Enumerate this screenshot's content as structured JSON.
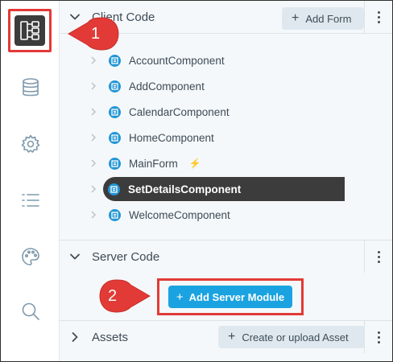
{
  "rail": {
    "items": [
      {
        "icon": "app-tree-icon",
        "active": true
      },
      {
        "icon": "database-icon"
      },
      {
        "icon": "gear-icon"
      },
      {
        "icon": "list-icon"
      },
      {
        "icon": "palette-icon"
      },
      {
        "icon": "search-icon"
      }
    ]
  },
  "sections": {
    "client": {
      "title": "Client Code",
      "button": "Add Form"
    },
    "server": {
      "title": "Server Code",
      "button": "Add Server Module"
    },
    "assets": {
      "title": "Assets",
      "button": "Create or upload Asset"
    }
  },
  "client_items": [
    {
      "label": "AccountComponent"
    },
    {
      "label": "AddComponent"
    },
    {
      "label": "CalendarComponent"
    },
    {
      "label": "HomeComponent"
    },
    {
      "label": "MainForm",
      "startup_icon": "lightning-icon"
    },
    {
      "label": "SetDetailsComponent",
      "selected": true
    },
    {
      "label": "WelcomeComponent"
    }
  ],
  "callouts": [
    {
      "number": "1"
    },
    {
      "number": "2"
    }
  ],
  "colors": {
    "accent": "#1aa3e0",
    "highlight": "#e23a36",
    "selected_bg": "#3c3c3c",
    "file_icon": "#2196d6"
  }
}
